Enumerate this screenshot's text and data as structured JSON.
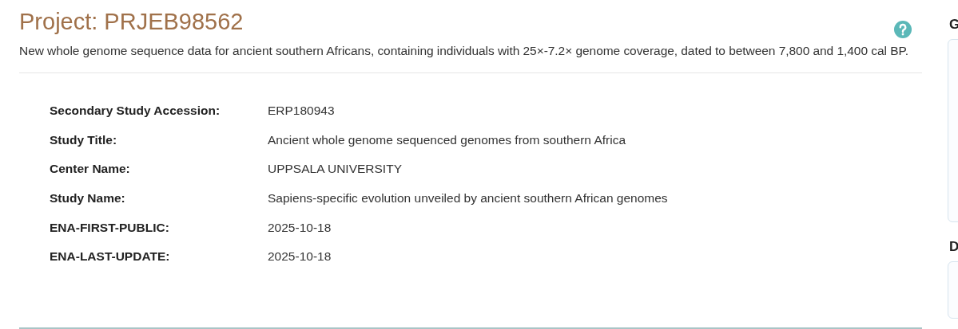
{
  "project": {
    "title": "Project: PRJEB98562",
    "description": "New whole genome sequence data for ancient southern Africans, containing individuals with 25×-7.2× genome coverage, dated to between 7,800 and 1,400 cal BP."
  },
  "attributes": [
    {
      "label": "Secondary Study Accession:",
      "value": "ERP180943"
    },
    {
      "label": "Study Title:",
      "value": "Ancient whole genome sequenced genomes from southern Africa"
    },
    {
      "label": "Center Name:",
      "value": "UPPSALA UNIVERSITY"
    },
    {
      "label": "Study Name:",
      "value": "Sapiens-specific evolution unveiled by ancient southern African genomes"
    },
    {
      "label": "ENA-FIRST-PUBLIC:",
      "value": "2025-10-18"
    },
    {
      "label": "ENA-LAST-UPDATE:",
      "value": "2025-10-18"
    }
  ],
  "sidebar": {
    "panels": [
      {
        "heading": "G"
      },
      {
        "heading": "D"
      }
    ]
  }
}
